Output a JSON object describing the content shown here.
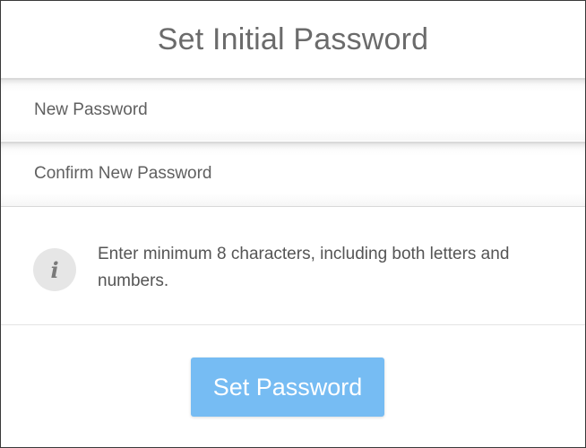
{
  "dialog": {
    "title": "Set Initial Password"
  },
  "fields": {
    "new_password": {
      "placeholder": "New Password",
      "value": ""
    },
    "confirm_password": {
      "placeholder": "Confirm New Password",
      "value": ""
    }
  },
  "info": {
    "icon": "info-icon",
    "glyph": "i",
    "text": "Enter minimum 8 characters, including both letters and numbers."
  },
  "actions": {
    "submit_label": "Set Password",
    "submit_color": "#76bcf3"
  }
}
